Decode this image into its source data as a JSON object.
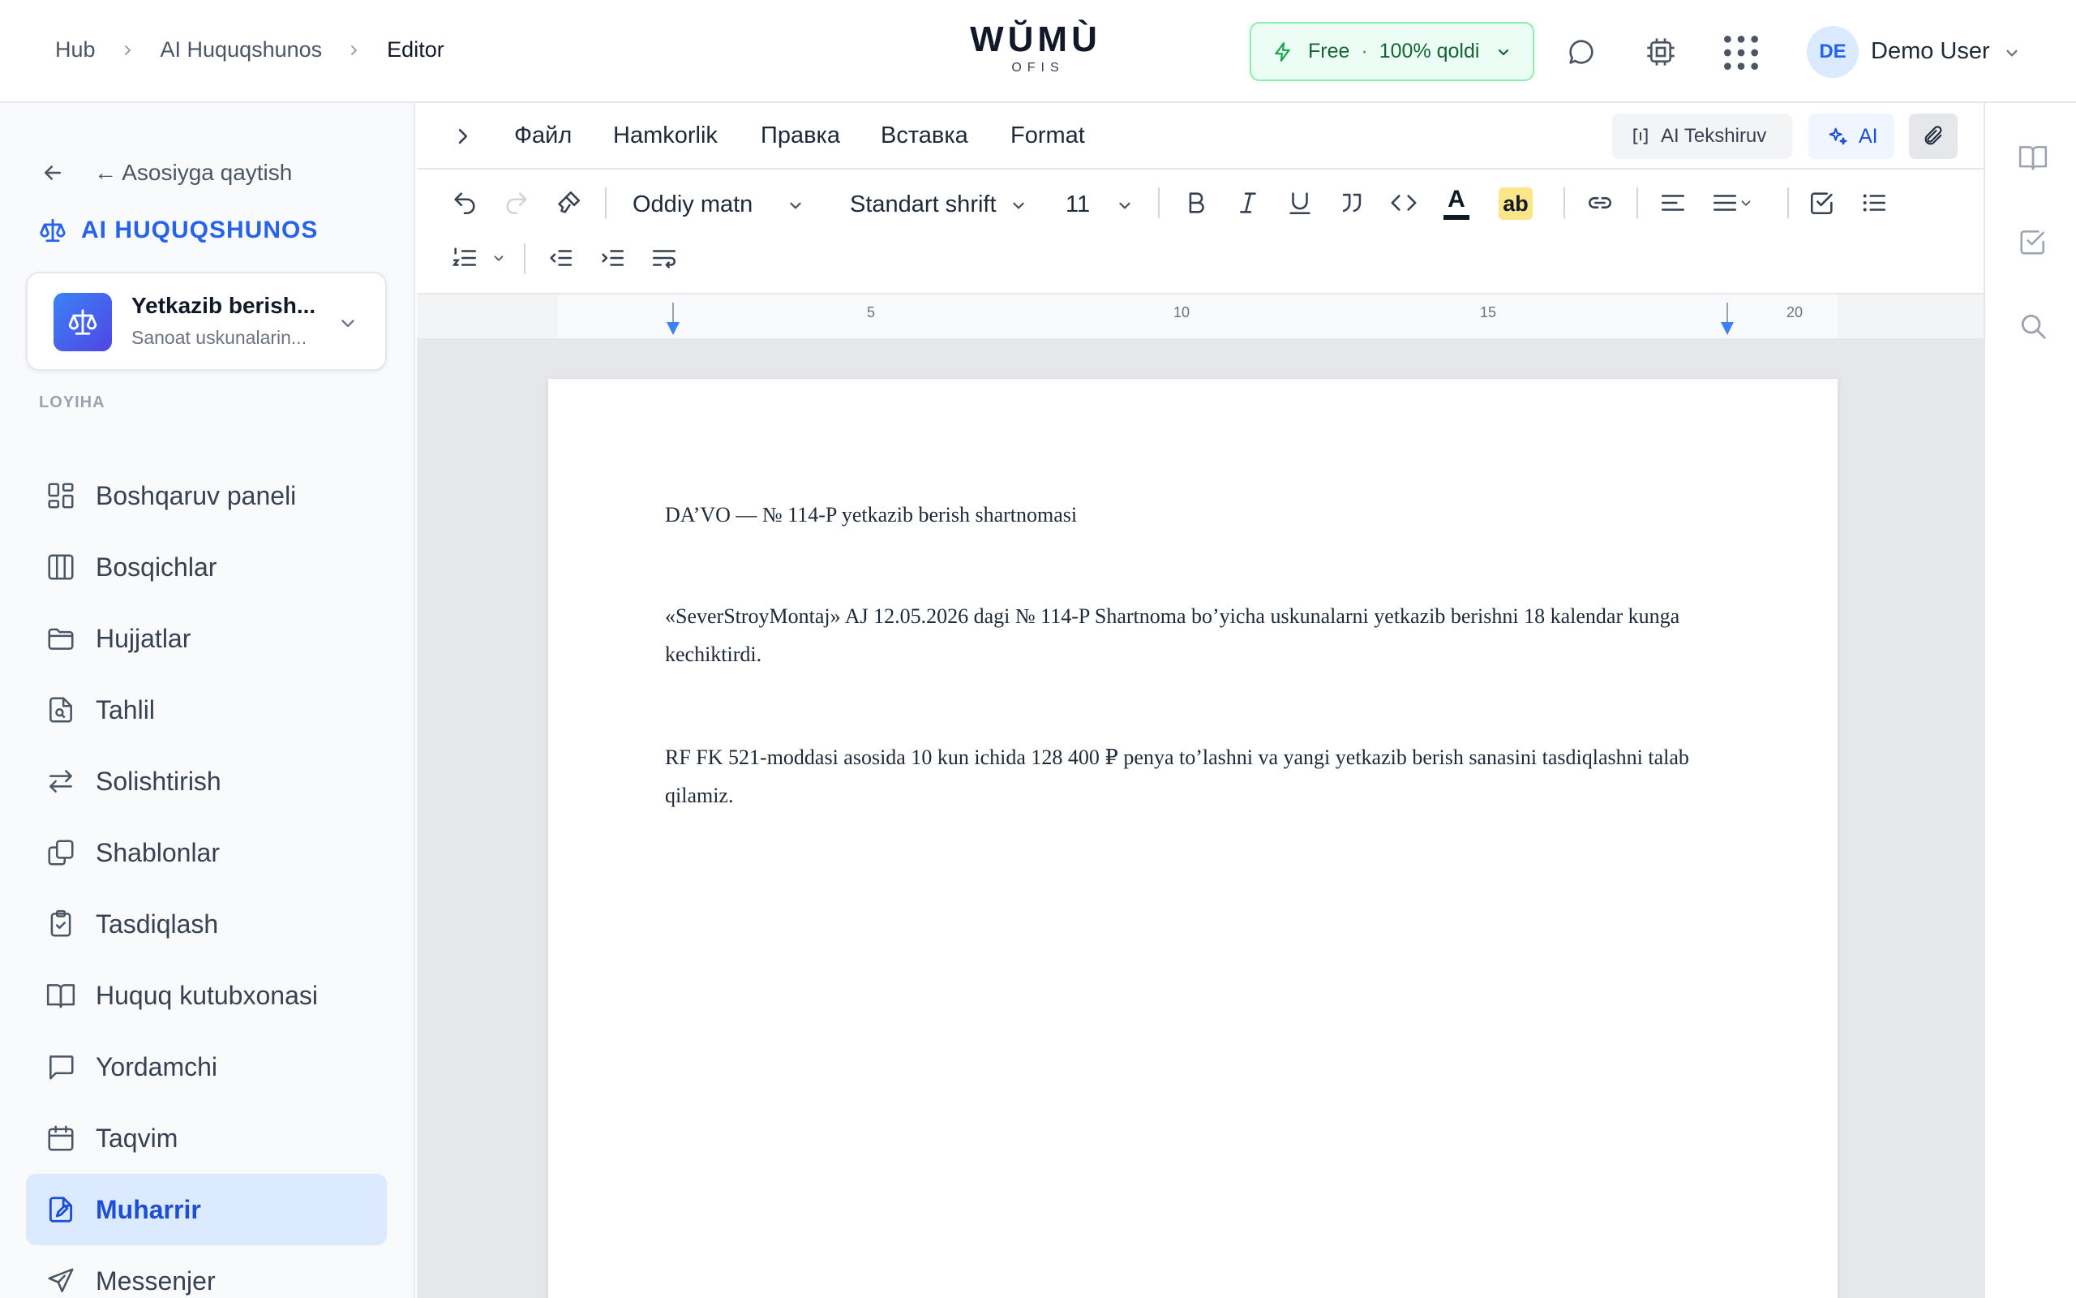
{
  "header": {
    "breadcrumbs": [
      "Hub",
      "AI Huquqshunos",
      "Editor"
    ],
    "logo_main": "WŬMÙ",
    "logo_sub": "OFIS",
    "plan": {
      "name": "Free",
      "separator": "·",
      "remaining": "100% qoldi"
    },
    "user": {
      "initials": "DE",
      "name": "Demo User"
    },
    "icons": [
      "chat-icon",
      "chip-icon",
      "apps-grid-icon"
    ]
  },
  "sidebar": {
    "back_label": "← Asosiyga qaytish",
    "brand": "AI HUQUQSHUNOS",
    "project": {
      "title": "Yetkazib berish...",
      "subtitle": "Sanoat uskunalarin..."
    },
    "section_label": "LOYIHA",
    "items": [
      {
        "label": "Boshqaruv paneli",
        "icon": "dashboard-icon"
      },
      {
        "label": "Bosqichlar",
        "icon": "columns-icon"
      },
      {
        "label": "Hujjatlar",
        "icon": "folder-icon"
      },
      {
        "label": "Tahlil",
        "icon": "file-search-icon"
      },
      {
        "label": "Solishtirish",
        "icon": "compare-arrows-icon"
      },
      {
        "label": "Shablonlar",
        "icon": "copy-icon"
      },
      {
        "label": "Tasdiqlash",
        "icon": "clipboard-check-icon"
      },
      {
        "label": "Huquq kutubxonasi",
        "icon": "book-icon"
      },
      {
        "label": "Yordamchi",
        "icon": "message-square-icon"
      },
      {
        "label": "Taqvim",
        "icon": "calendar-icon"
      },
      {
        "label": "Muharrir",
        "icon": "file-edit-icon",
        "active": true
      },
      {
        "label": "Messenjer",
        "icon": "send-icon"
      }
    ]
  },
  "menubar": {
    "items": [
      "Файл",
      "Hamkorlik",
      "Правка",
      "Вставка",
      "Format"
    ],
    "ai_check": "AI Tekshiruv",
    "ai": "AI"
  },
  "toolbar": {
    "style": "Oddiy matn",
    "font": "Standart shrift",
    "size": "11",
    "text_color_glyph": "A",
    "highlight_glyph": "ab"
  },
  "ruler": {
    "ticks": [
      "5",
      "10",
      "15",
      "20"
    ]
  },
  "document": {
    "paragraphs": [
      "DA’VO — № 114-P yetkazib berish shartnomasi",
      "«SeverStroyMontaj» AJ 12.05.2026 dagi № 114-P Shartnoma bo’yicha uskunalarni yetkazib berishni 18 kalendar kunga kechiktirdi.",
      "RF FK 521-moddasi asosida 10 kun ichida 128 400 ₽ penya to’lashni va yangi yetkazib berish sanasini tasdiqlashni talab qilamiz."
    ]
  },
  "colors": {
    "accent": "#2563eb",
    "active_bg": "#dbeafe",
    "plan_green": "#166534",
    "highlight": "#fde68a"
  }
}
